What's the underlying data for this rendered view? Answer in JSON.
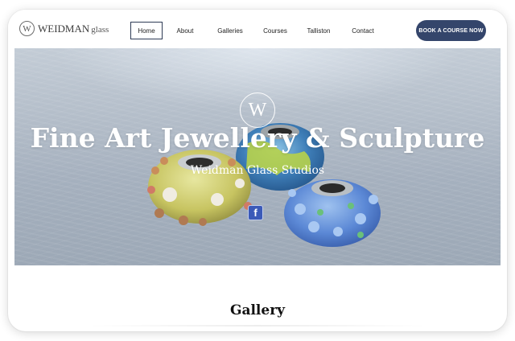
{
  "brand": {
    "logo_mark": "W",
    "name": "WEIDMAN",
    "name_suffix": "glass"
  },
  "nav": {
    "items": [
      {
        "label": "Home",
        "active": true
      },
      {
        "label": "About"
      },
      {
        "label": "Galleries"
      },
      {
        "label": "Courses"
      },
      {
        "label": "Talliston"
      },
      {
        "label": "Contact"
      }
    ],
    "cta_label": "BOOK A COURSE NOW"
  },
  "hero": {
    "emblem": "W",
    "title": "Fine Art Jewellery & Sculpture",
    "subtitle": "Weidman Glass Studios",
    "social_icon": "facebook-icon",
    "social_glyph": "f"
  },
  "gallery": {
    "heading": "Gallery"
  },
  "colors": {
    "accent": "#34456b",
    "facebook": "#3b5ab8"
  }
}
